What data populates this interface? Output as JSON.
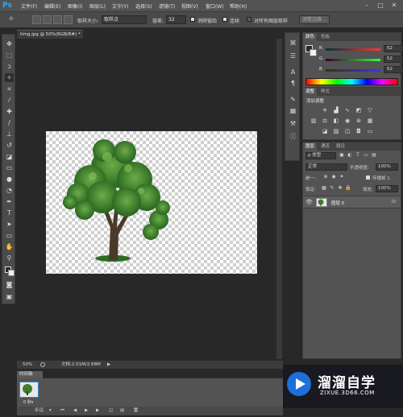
{
  "menubar": {
    "logo": "Ps",
    "items": [
      "文件(F)",
      "编辑(E)",
      "图像(I)",
      "图层(L)",
      "文字(Y)",
      "选择(S)",
      "滤镜(T)",
      "视图(V)",
      "窗口(W)",
      "帮助(H)"
    ],
    "window_controls": [
      "–",
      "□",
      "✕"
    ]
  },
  "options": {
    "sample_size_label": "取样大小:",
    "sample_size_value": "取样点",
    "tolerance_label": "容差:",
    "tolerance_value": "32",
    "antialias_label": "消除锯齿",
    "contiguous_label": "连续",
    "all_layers_label": "对所有图层取样",
    "refine_edge_label": "调整边缘..."
  },
  "document": {
    "tab_title": "timg.jpg @ 50%(RGB/8#) *",
    "zoom": "50%",
    "doc_info": "文档:2.01M/2.68M"
  },
  "timeline": {
    "tab_label": "时间轴",
    "frame_time": "0 秒▾",
    "loop_option": "永远"
  },
  "color_panel": {
    "tabs": [
      "颜色",
      "色板"
    ],
    "r_label": "R",
    "g_label": "G",
    "b_label": "B",
    "r_value": "52",
    "g_value": "52",
    "b_value": "52"
  },
  "adjust_panel": {
    "tabs": [
      "调整",
      "样式"
    ],
    "title": "添加调整"
  },
  "layers_panel": {
    "tabs": [
      "图层",
      "通道",
      "路径"
    ],
    "filter_value": "ρ 类型",
    "blend_mode": "正常",
    "opacity_label": "不透明度:",
    "opacity_value": "100%",
    "unify_label": "统一:",
    "propagate_label": "传播帧 1",
    "lock_label": "锁定:",
    "fill_label": "填充:",
    "fill_value": "100%",
    "layer_name": "图层 0"
  },
  "watermark": {
    "title": "溜溜自学",
    "url": "ZIXUE.3D66.COM"
  },
  "colors": {
    "accent_blue": "#1e6fd9",
    "foreground_swatch": "#2a2a2a",
    "background_swatch": "#f0f0f0"
  }
}
